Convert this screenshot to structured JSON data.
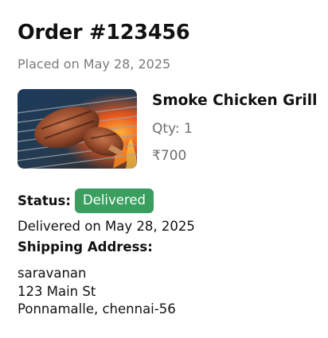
{
  "order": {
    "title": "Order #123456",
    "placed_on": "Placed on May 28, 2025"
  },
  "item": {
    "name": "Smoke Chicken Grill",
    "qty": "Qty: 1",
    "price": "₹700",
    "image_icon": "grilled-chicken-photo"
  },
  "status": {
    "label": "Status:",
    "badge": "Delivered",
    "badge_color": "#3a9e5e",
    "delivered_on": "Delivered on May 28, 2025"
  },
  "shipping": {
    "label": "Shipping Address:",
    "lines": [
      "saravanan",
      "123 Main St",
      "Ponnamalle, chennai-56"
    ]
  }
}
